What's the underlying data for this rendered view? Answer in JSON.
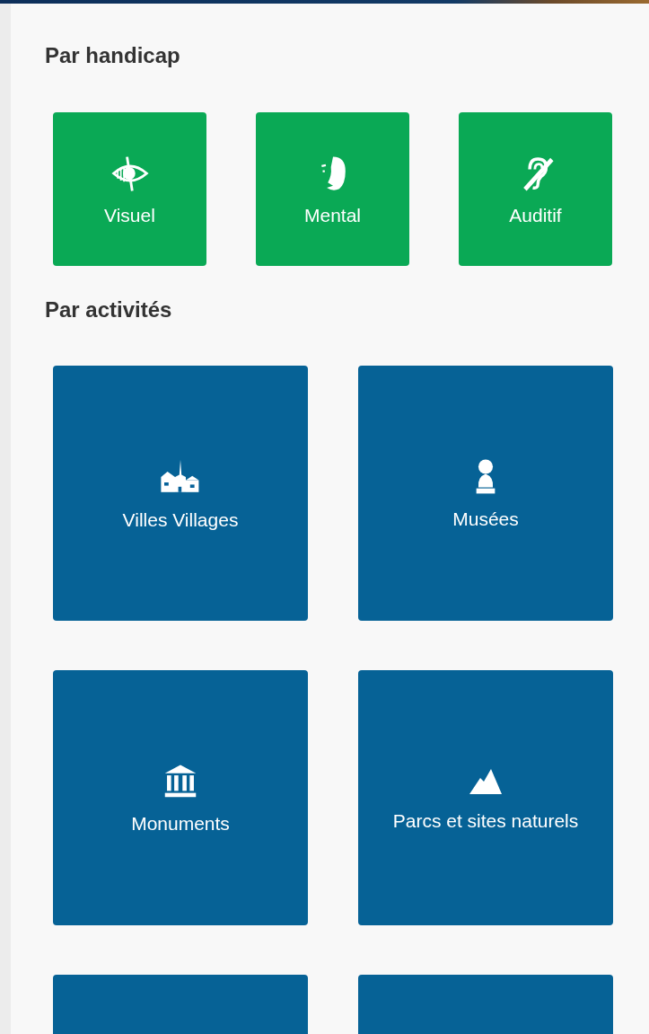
{
  "handicap_section": {
    "title": "Par handicap",
    "tiles": [
      {
        "label": "Visuel"
      },
      {
        "label": "Mental"
      },
      {
        "label": "Auditif"
      }
    ]
  },
  "activities_section": {
    "title": "Par activités",
    "tiles": [
      {
        "kind": "full",
        "label": "Villes Villages"
      },
      {
        "kind": "full",
        "label": "Musées"
      },
      {
        "kind": "full",
        "label": "Monuments"
      },
      {
        "kind": "full",
        "label": "Parcs et sites naturels"
      },
      {
        "kind": "cut"
      },
      {
        "kind": "cut"
      }
    ]
  }
}
